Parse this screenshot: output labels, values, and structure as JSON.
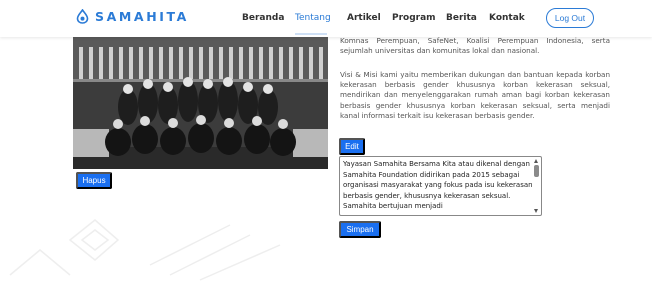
{
  "brand": {
    "name": "SAMAHITA",
    "icon": "drop-logo-icon"
  },
  "nav": {
    "items": [
      {
        "label": "Beranda",
        "active": false
      },
      {
        "label": "Tentang",
        "active": true
      },
      {
        "label": "Artikel",
        "active": false
      },
      {
        "label": "Program",
        "active": false
      },
      {
        "label": "Berita",
        "active": false
      },
      {
        "label": "Kontak",
        "active": false
      }
    ],
    "logout_label": "Log Out"
  },
  "colors": {
    "accent": "#2b7bd6",
    "button": "#1a6ff0"
  },
  "content": {
    "para1": "Komnas Perempuan, SafeNet, Koalisi Perempuan Indonesia, serta sejumlah universitas dan komunitas lokal dan nasional.",
    "para2": "Visi & Misi kami yaitu memberikan dukungan dan bantuan kepada korban kekerasan berbasis gender khususnya korban kekerasan seksual, mendirikan dan menyelenggarakan rumah aman bagi korban kekerasan berbasis gender khususnya korban kekerasan seksual, serta menjadi kanal informasi terkait isu kekerasan berbasis gender.",
    "hapus_label": "Hapus",
    "edit_label": "Edit",
    "simpan_label": "Simpan",
    "textarea_value": "Yayasan Samahita Bersama Kita atau dikenal dengan Samahita Foundation didirikan pada 2015 sebagai organisasi masyarakat yang fokus pada isu kekerasan berbasis gender, khususnya kekerasan seksual. Samahita bertujuan menjadi"
  }
}
